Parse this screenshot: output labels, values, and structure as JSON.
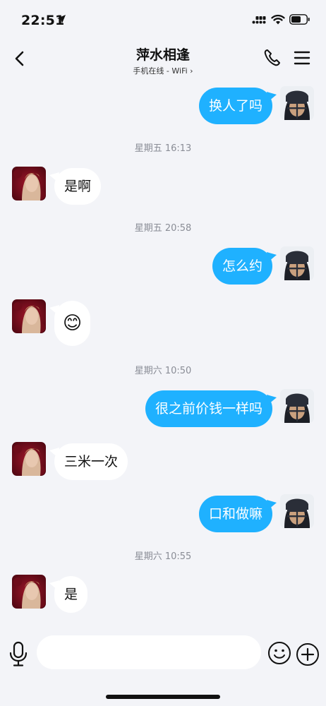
{
  "status_bar": {
    "time": "22:51"
  },
  "header": {
    "title": "萍水相逢",
    "subtitle": "手机在线 - WiFi ›"
  },
  "messages": [
    {
      "from": "me",
      "text": "换人了吗"
    },
    {
      "timestamp": "星期五 16:13"
    },
    {
      "from": "her",
      "text": "是啊"
    },
    {
      "timestamp": "星期五 20:58"
    },
    {
      "from": "me",
      "text": "怎么约"
    },
    {
      "from": "her",
      "text": "😊",
      "type": "emoji"
    },
    {
      "timestamp": "星期六 10:50"
    },
    {
      "from": "me",
      "text": "很之前价钱一样吗"
    },
    {
      "from": "her",
      "text": "三米一次"
    },
    {
      "from": "me",
      "text": "口和做嘛"
    },
    {
      "timestamp": "星期六 10:55"
    },
    {
      "from": "her",
      "text": "是"
    }
  ],
  "input": {
    "placeholder": "",
    "value": ""
  },
  "colors": {
    "sent_bubble": "#1fb1ff",
    "received_bubble": "#ffffff",
    "background": "#f3f4f8"
  },
  "icons": [
    "location-arrow-icon",
    "signal-icon",
    "wifi-icon",
    "battery-icon",
    "back-icon",
    "phone-icon",
    "menu-icon",
    "mic-icon",
    "emoji-icon",
    "plus-icon"
  ]
}
